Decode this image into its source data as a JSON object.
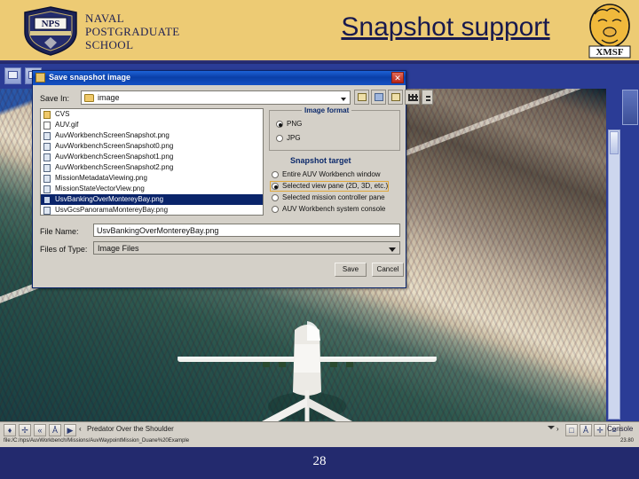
{
  "header": {
    "title": "Snapshot support",
    "institution_lines": [
      "NAVAL",
      "POSTGRADUATE",
      "SCHOOL"
    ],
    "nps_logo_text": "NPS",
    "xmsf_logo_text": "XMSF",
    "banner_color": "#edcb74",
    "title_color": "#18194e"
  },
  "dialog": {
    "title": "Save snapshot image",
    "icon": "app-icon",
    "close_label": "✕",
    "save_in_label": "Save In:",
    "save_in_value": "image",
    "nav_buttons": [
      {
        "name": "up-one-level-icon",
        "label": ""
      },
      {
        "name": "home-folder-icon",
        "label": ""
      },
      {
        "name": "create-new-folder-icon",
        "label": ""
      },
      {
        "name": "list-view-icon",
        "label": ""
      },
      {
        "name": "details-view-icon",
        "label": ""
      }
    ],
    "files": [
      {
        "name": "CVS",
        "type": "folder"
      },
      {
        "name": "AUV.gif",
        "type": "file"
      },
      {
        "name": "AuvWorkbenchScreenSnapshot.png",
        "type": "image"
      },
      {
        "name": "AuvWorkbenchScreenSnapshot0.png",
        "type": "image"
      },
      {
        "name": "AuvWorkbenchScreenSnapshot1.png",
        "type": "image"
      },
      {
        "name": "AuvWorkbenchScreenSnapshot2.png",
        "type": "image"
      },
      {
        "name": "MissionMetadataViewing.png",
        "type": "image"
      },
      {
        "name": "MissionStateVectorView.png",
        "type": "image"
      },
      {
        "name": "UsvBankingOverMontereyBay.png",
        "type": "image",
        "selected": true
      },
      {
        "name": "UsvGcsPanoramaMontereyBay.png",
        "type": "image"
      }
    ],
    "image_format": {
      "legend": "Image format",
      "options": [
        {
          "label": "PNG",
          "selected": true
        },
        {
          "label": "JPG",
          "selected": false
        }
      ]
    },
    "snapshot_target": {
      "title": "Snapshot target",
      "options": [
        {
          "label": "Entire AUV Workbench window",
          "selected": false
        },
        {
          "label": "Selected view pane (2D, 3D, etc.)",
          "selected": true
        },
        {
          "label": "Selected mission controller pane",
          "selected": false
        },
        {
          "label": "AUV Workbench system console",
          "selected": false
        }
      ]
    },
    "file_name_label": "File Name:",
    "file_name_value": "UsvBankingOverMontereyBay.png",
    "files_of_type_label": "Files of Type:",
    "files_of_type_value": "Image Files",
    "save_button": "Save",
    "cancel_button": "Cancel"
  },
  "app": {
    "toolbar_buttons": [
      {
        "name": "open-mission-icon"
      },
      {
        "name": "save-mission-icon"
      }
    ],
    "bottom_buttons": [
      {
        "name": "compass-icon",
        "glyph": "♦"
      },
      {
        "name": "pan-icon",
        "glyph": "✢"
      },
      {
        "name": "rewind-icon",
        "glyph": "«"
      },
      {
        "name": "person-icon",
        "glyph": "Å"
      },
      {
        "name": "play-icon",
        "glyph": "▶"
      }
    ],
    "viewpoint_prev_glyph": "‹",
    "viewpoint_label": "Predator Over the Shoulder",
    "viewpoint_next_glyph": "›",
    "right_buttons": [
      {
        "name": "delete-icon",
        "glyph": "□"
      },
      {
        "name": "binoculars-icon",
        "glyph": "Å"
      },
      {
        "name": "move-icon",
        "glyph": "✛"
      },
      {
        "name": "measure-icon",
        "glyph": "≡"
      }
    ],
    "console_label": "Console",
    "status_path": "file:/C:/nps/AuvWorkbench/Missions/AuvWaypointMission_Duane%20Example",
    "status_size": "23.80",
    "viewport_scene": "UAV flying over Monterey Bay coastline"
  },
  "footer": {
    "page_number": "28"
  }
}
